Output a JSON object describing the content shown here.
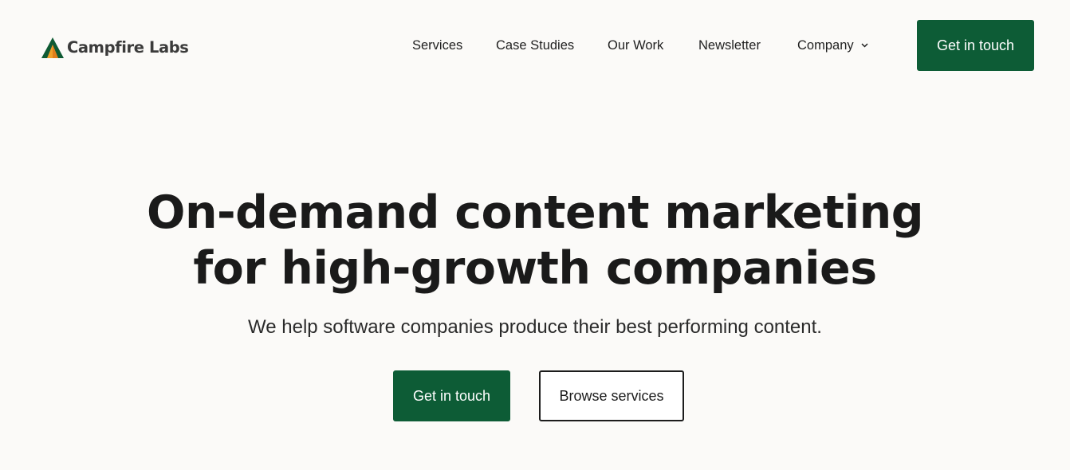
{
  "brand": {
    "name": "Campfire Labs",
    "logo_icon": "campfire-tent-icon",
    "colors": {
      "green": "#0d5c36",
      "orange": "#f0a12b",
      "dark_green": "#0e4f2e"
    }
  },
  "nav": {
    "items": [
      {
        "label": "Services"
      },
      {
        "label": "Case Studies"
      },
      {
        "label": "Our Work"
      },
      {
        "label": "Newsletter"
      },
      {
        "label": "Company",
        "icon": "chevron-down-icon"
      }
    ],
    "cta_label": "Get in touch"
  },
  "hero": {
    "headline_line1": "On-demand content marketing",
    "headline_line2": "for high-growth companies",
    "subheadline": "We help software companies produce their best performing content.",
    "primary_cta": "Get in touch",
    "secondary_cta": "Browse services"
  },
  "colors": {
    "background": "#fbfaf8",
    "primary_button": "#0d5c36",
    "text": "#1c1c1c"
  }
}
